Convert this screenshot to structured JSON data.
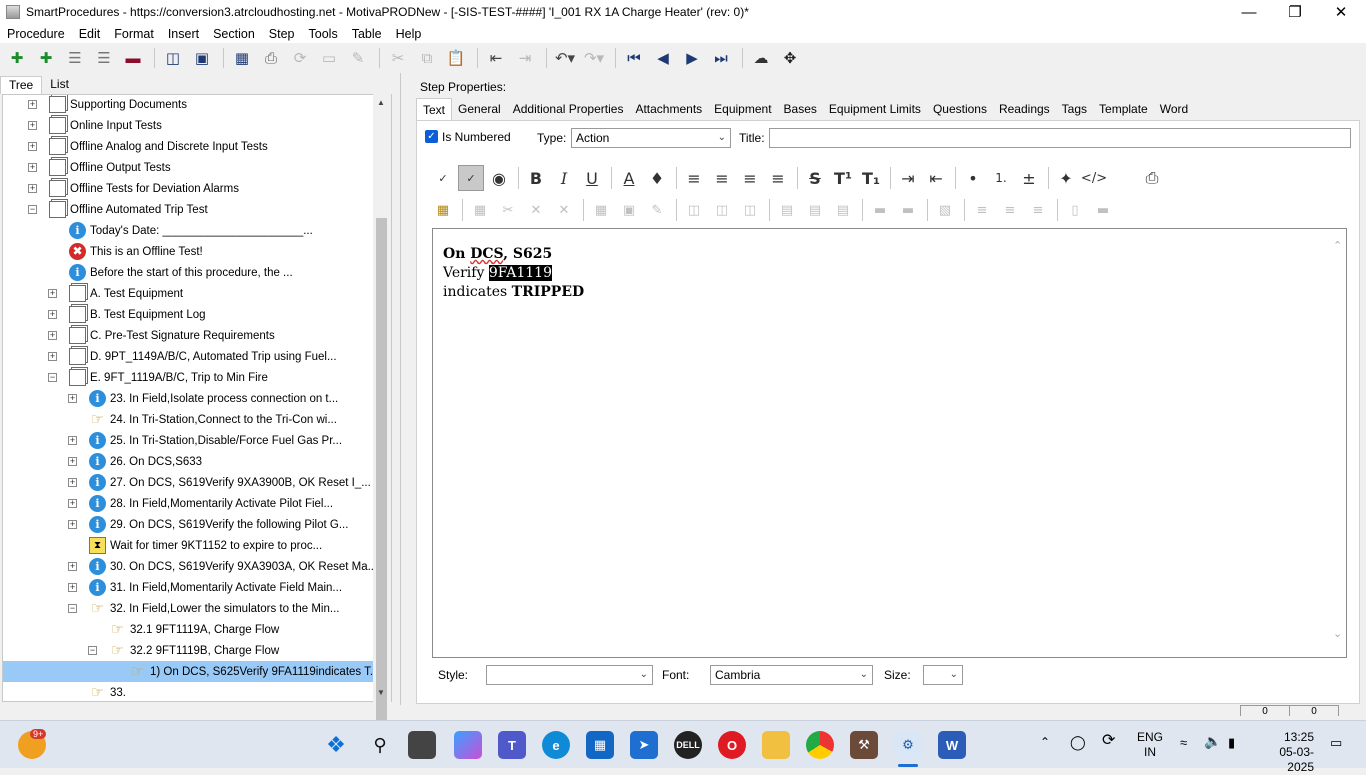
{
  "window": {
    "title": "SmartProcedures - https://conversion3.atrcloudhosting.net - MotivaPRODNew - [-SIS-TEST-####] 'I_001 RX 1A Charge Heater' (rev: 0)*"
  },
  "menu": [
    "Procedure",
    "Edit",
    "Format",
    "Insert",
    "Section",
    "Step",
    "Tools",
    "Table",
    "Help"
  ],
  "left_tabs": [
    "Tree",
    "List"
  ],
  "tree": [
    {
      "text": "Supporting Documents",
      "icon": "doc-icon",
      "level": 0,
      "exp": "+"
    },
    {
      "text": "Online Input Tests",
      "icon": "doc-icon",
      "level": 0,
      "exp": "+"
    },
    {
      "text": "Offline Analog and Discrete Input Tests",
      "icon": "doc-icon",
      "level": 0,
      "exp": "+"
    },
    {
      "text": "Offline Output Tests",
      "icon": "doc-icon",
      "level": 0,
      "exp": "+"
    },
    {
      "text": "Offline Tests for Deviation Alarms",
      "icon": "doc-icon",
      "level": 0,
      "exp": "+"
    },
    {
      "text": "Offline Automated Trip Test",
      "icon": "doc-icon",
      "level": 0,
      "exp": "-"
    },
    {
      "text": "Today's Date: ______________________...",
      "icon": "info-icon",
      "level": 1,
      "exp": ""
    },
    {
      "text": "This is an Offline Test!",
      "icon": "error-icon",
      "level": 1,
      "exp": ""
    },
    {
      "text": "Before the start of this procedure, the ...",
      "icon": "info-icon",
      "level": 1,
      "exp": ""
    },
    {
      "text": "A. Test Equipment",
      "icon": "doc-icon",
      "level": 1,
      "exp": "+"
    },
    {
      "text": "B. Test Equipment Log",
      "icon": "doc-icon",
      "level": 1,
      "exp": "+"
    },
    {
      "text": "C. Pre-Test Signature Requirements",
      "icon": "doc-icon",
      "level": 1,
      "exp": "+"
    },
    {
      "text": "D. 9PT_1149A/B/C, Automated Trip using Fuel...",
      "icon": "doc-icon",
      "level": 1,
      "exp": "+"
    },
    {
      "text": "E. 9FT_1119A/B/C, Trip to Min Fire",
      "icon": "doc-icon",
      "level": 1,
      "exp": "-"
    },
    {
      "text": "23. In Field,Isolate process connection on t...",
      "icon": "info-icon",
      "level": 2,
      "exp": "+"
    },
    {
      "text": "24. In Tri-Station,Connect to the Tri-Con wi...",
      "icon": "hand-icon",
      "level": 2,
      "exp": ""
    },
    {
      "text": "25. In Tri-Station,Disable/Force Fuel Gas Pr...",
      "icon": "info-icon",
      "level": 2,
      "exp": "+"
    },
    {
      "text": "26. On DCS,S633",
      "icon": "info-icon",
      "level": 2,
      "exp": "+"
    },
    {
      "text": "27. On DCS, S619Verify 9XA3900B, OK Reset I_...",
      "icon": "info-icon",
      "level": 2,
      "exp": "+"
    },
    {
      "text": "28. In Field,Momentarily Activate Pilot Fiel...",
      "icon": "info-icon",
      "level": 2,
      "exp": "+"
    },
    {
      "text": "29. On DCS, S619Verify the following Pilot G...",
      "icon": "info-icon",
      "level": 2,
      "exp": "+"
    },
    {
      "text": "Wait for timer 9KT1152 to expire to proc...",
      "icon": "timer-icon",
      "level": 2,
      "exp": ""
    },
    {
      "text": "30. On DCS, S619Verify 9XA3903A, OK Reset Ma...",
      "icon": "info-icon",
      "level": 2,
      "exp": "+"
    },
    {
      "text": "31. In Field,Momentarily Activate Field Main...",
      "icon": "info-icon",
      "level": 2,
      "exp": "+"
    },
    {
      "text": "32. In Field,Lower the simulators to the Min...",
      "icon": "hand-icon",
      "level": 2,
      "exp": "-"
    },
    {
      "text": "32.1 9FT1119A, Charge Flow",
      "icon": "hand-icon",
      "level": 3,
      "exp": ""
    },
    {
      "text": "32.2 9FT1119B, Charge Flow",
      "icon": "hand-icon",
      "level": 3,
      "exp": "-"
    },
    {
      "text": "1) On DCS, S625Verify 9FA1119indicates T...",
      "icon": "hand-icon",
      "level": 4,
      "exp": "",
      "selected": true
    },
    {
      "text": "33.",
      "icon": "hand-icon",
      "level": 2,
      "exp": ""
    }
  ],
  "step_properties": {
    "label": "Step Properties:",
    "tabs": [
      "Text",
      "General",
      "Additional Properties",
      "Attachments",
      "Equipment",
      "Bases",
      "Equipment Limits",
      "Questions",
      "Readings",
      "Tags",
      "Template",
      "Word"
    ],
    "is_numbered_label": "Is Numbered",
    "type_label": "Type:",
    "type_value": "Action",
    "title_label": "Title:",
    "title_value": ""
  },
  "editor": {
    "line1_a": "On ",
    "line1_b": "DCS",
    "line1_c": ", S625",
    "line2_a": "Verify ",
    "line2_hl": "9FA1119",
    "line3_a": "indicates ",
    "line3_b": "TRIPPED"
  },
  "footer": {
    "style_label": "Style:",
    "style_value": "",
    "font_label": "Font:",
    "font_value": "Cambria",
    "size_label": "Size:",
    "size_value": ""
  },
  "bottom_indicators": [
    "0",
    "0"
  ],
  "taskbar": {
    "notif_badge": "9+",
    "lang_top": "ENG",
    "lang_bottom": "IN",
    "time": "13:25",
    "date": "05-03-2025"
  }
}
